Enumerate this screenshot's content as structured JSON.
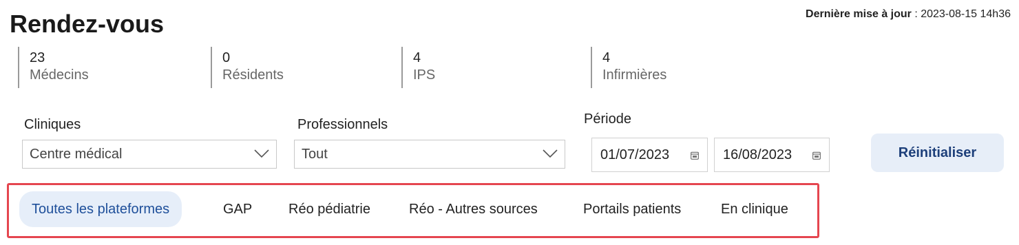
{
  "page": {
    "title": "Rendez-vous",
    "last_update_label": "Dernière mise à jour",
    "last_update_value": " : 2023-08-15 14h36"
  },
  "stats": [
    {
      "value": "23",
      "label": "Médecins"
    },
    {
      "value": "0",
      "label": "Résidents"
    },
    {
      "value": "4",
      "label": "IPS"
    },
    {
      "value": "4",
      "label": "Infirmières"
    }
  ],
  "filters": {
    "cliniques_label": "Cliniques",
    "cliniques_value": "Centre médical",
    "professionnels_label": "Professionnels",
    "professionnels_value": "Tout",
    "periode_label": "Période",
    "date_start": "01/07/2023",
    "date_end": "16/08/2023",
    "reset_label": "Réinitialiser"
  },
  "tabs": [
    {
      "label": "Toutes les plateformes",
      "active": true
    },
    {
      "label": "GAP"
    },
    {
      "label": "Réo pédiatrie"
    },
    {
      "label": "Réo - Autres sources"
    },
    {
      "label": "Portails patients"
    },
    {
      "label": "En clinique"
    }
  ],
  "colors": {
    "accent": "#1e4f9a",
    "active_tab_bg": "#e6eef9",
    "highlight_border": "#e5464f"
  },
  "icons": {
    "dropdown": "chevron-down-icon",
    "date": "calendar-icon"
  }
}
